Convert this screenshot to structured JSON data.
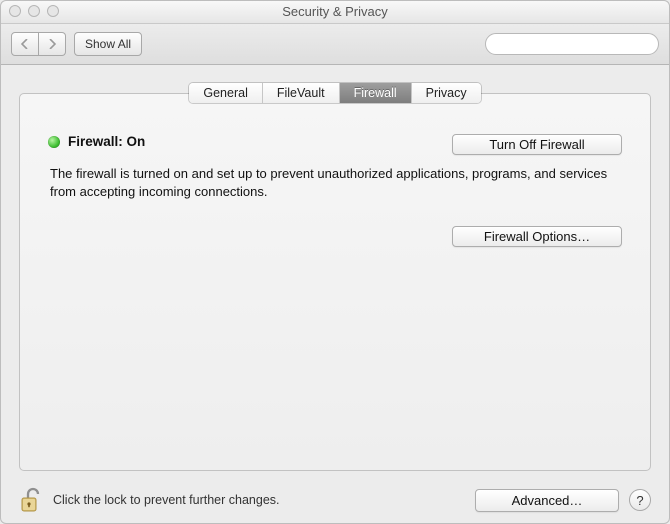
{
  "window": {
    "title": "Security & Privacy"
  },
  "toolbar": {
    "show_all": "Show All",
    "search_placeholder": ""
  },
  "tabs": {
    "general": "General",
    "filevault": "FileVault",
    "firewall": "Firewall",
    "privacy": "Privacy",
    "selected": "firewall"
  },
  "firewall": {
    "status_title": "Firewall: On",
    "turn_off_label": "Turn Off Firewall",
    "description": "The firewall is turned on and set up to prevent unauthorized applications, programs, and services from accepting incoming connections.",
    "options_label": "Firewall Options…"
  },
  "footer": {
    "lock_text": "Click the lock to prevent further changes.",
    "advanced_label": "Advanced…",
    "help_label": "?"
  }
}
